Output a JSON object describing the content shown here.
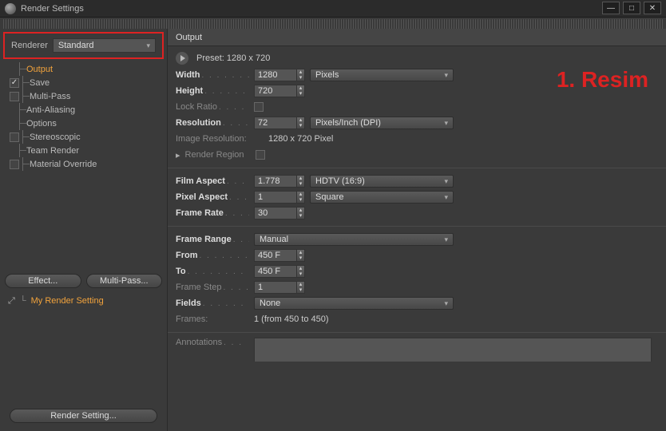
{
  "window": {
    "title": "Render Settings"
  },
  "watermark": "1. Resim",
  "renderer": {
    "label": "Renderer",
    "value": "Standard"
  },
  "tree": {
    "output": "Output",
    "save": "Save",
    "multipass": "Multi-Pass",
    "antialias": "Anti-Aliasing",
    "options": "Options",
    "stereo": "Stereoscopic",
    "team": "Team Render",
    "material": "Material Override"
  },
  "sidebar_buttons": {
    "effect": "Effect...",
    "multipass": "Multi-Pass..."
  },
  "mysetting": {
    "label": "My Render Setting"
  },
  "bottom_button": "Render Setting...",
  "panel": {
    "title": "Output"
  },
  "preset": {
    "label": "Preset: 1280 x 720"
  },
  "fields": {
    "width": {
      "label": "Width",
      "value": "1280",
      "unit": "Pixels"
    },
    "height": {
      "label": "Height",
      "value": "720"
    },
    "lockratio": {
      "label": "Lock Ratio"
    },
    "resolution": {
      "label": "Resolution",
      "value": "72",
      "unit": "Pixels/Inch (DPI)"
    },
    "imageres": {
      "label": "Image Resolution:",
      "value": "1280 x 720 Pixel"
    },
    "renderregion": {
      "label": "Render Region"
    },
    "filmaspect": {
      "label": "Film Aspect",
      "value": "1.778",
      "preset": "HDTV (16:9)"
    },
    "pixelaspect": {
      "label": "Pixel Aspect",
      "value": "1",
      "preset": "Square"
    },
    "framerate": {
      "label": "Frame Rate",
      "value": "30"
    },
    "framerange": {
      "label": "Frame Range",
      "value": "Manual"
    },
    "from": {
      "label": "From",
      "value": "450 F"
    },
    "to": {
      "label": "To",
      "value": "450 F"
    },
    "framestep": {
      "label": "Frame Step",
      "value": "1"
    },
    "fieldsopt": {
      "label": "Fields",
      "value": "None"
    },
    "frames": {
      "label": "Frames:",
      "value": "1 (from 450 to 450)"
    },
    "annotations": {
      "label": "Annotations"
    }
  },
  "chart_data": null
}
